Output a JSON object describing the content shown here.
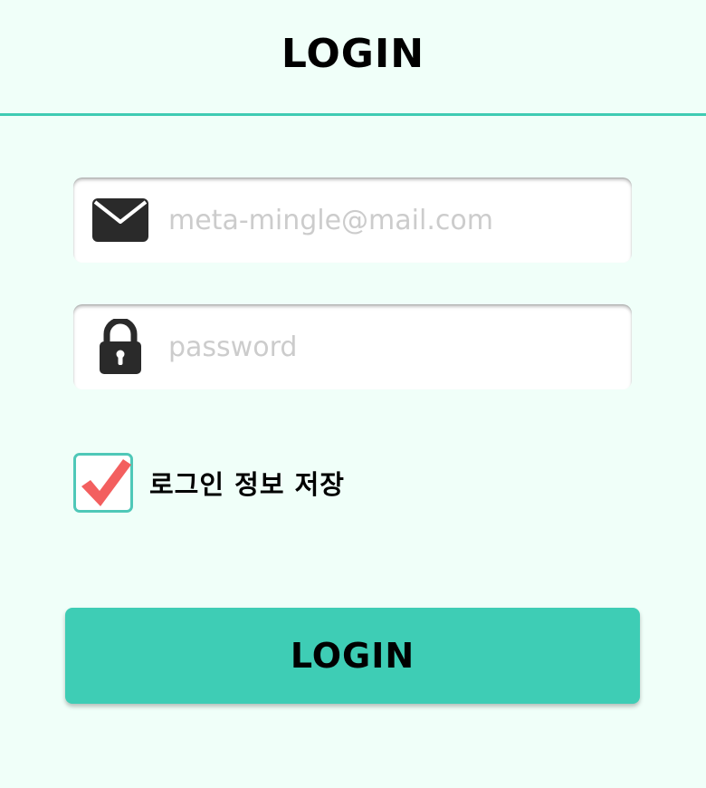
{
  "header": {
    "title": "LOGIN"
  },
  "email_field": {
    "icon": "envelope-icon",
    "placeholder": "meta-mingle@mail.com",
    "value": ""
  },
  "password_field": {
    "icon": "lock-icon",
    "placeholder": "password",
    "value": ""
  },
  "remember": {
    "checked": true,
    "icon": "checkmark-icon",
    "label": "로그인 정보 저장"
  },
  "login_button": {
    "label": "LOGIN"
  },
  "colors": {
    "background": "#f0fff9",
    "accent": "#3fcbb3",
    "checkmark": "#f35f5f",
    "icon": "#2a2a2a",
    "placeholder": "#cccccc"
  }
}
